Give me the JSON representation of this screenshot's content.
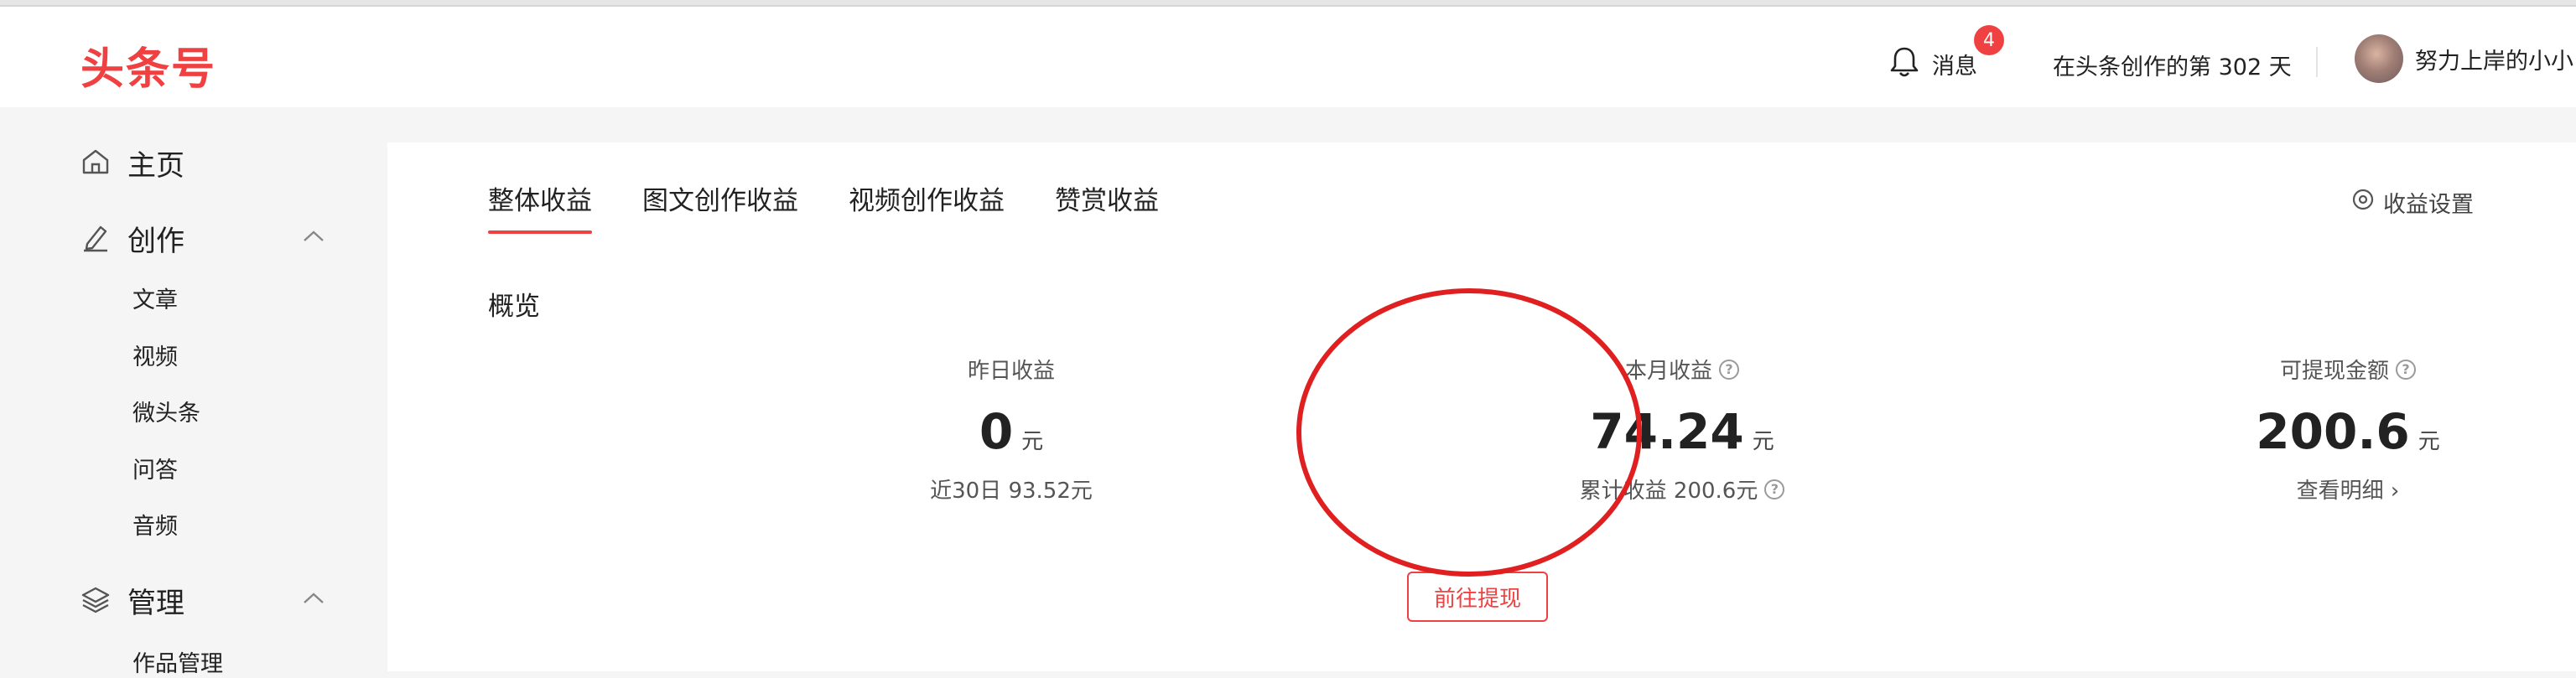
{
  "header": {
    "logo": "头条号",
    "messages_label": "消息",
    "messages_badge": "4",
    "creation_days": "在头条创作的第 302 天",
    "username": "努力上岸的小小"
  },
  "sidebar": {
    "home": "主页",
    "create_group": "创作",
    "create_items": [
      "文章",
      "视频",
      "微头条",
      "问答",
      "音频"
    ],
    "manage_group": "管理",
    "manage_items": [
      "作品管理"
    ]
  },
  "tabs": [
    "整体收益",
    "图文创作收益",
    "视频创作收益",
    "赞赏收益"
  ],
  "active_tab": "整体收益",
  "settings_label": "收益设置",
  "overview": {
    "title": "概览",
    "yesterday": {
      "label": "昨日收益",
      "value": "0",
      "unit": "元",
      "sub": "近30日 93.52元"
    },
    "this_month": {
      "label": "本月收益",
      "value": "74.24",
      "unit": "元",
      "sub": "累计收益 200.6元"
    },
    "withdrawable": {
      "label": "可提现金额",
      "value": "200.6",
      "unit": "元",
      "sub": "查看明细 ›"
    },
    "withdraw_button": "前往提现"
  },
  "colors": {
    "accent": "#f04142",
    "annotation": "#e02020"
  }
}
